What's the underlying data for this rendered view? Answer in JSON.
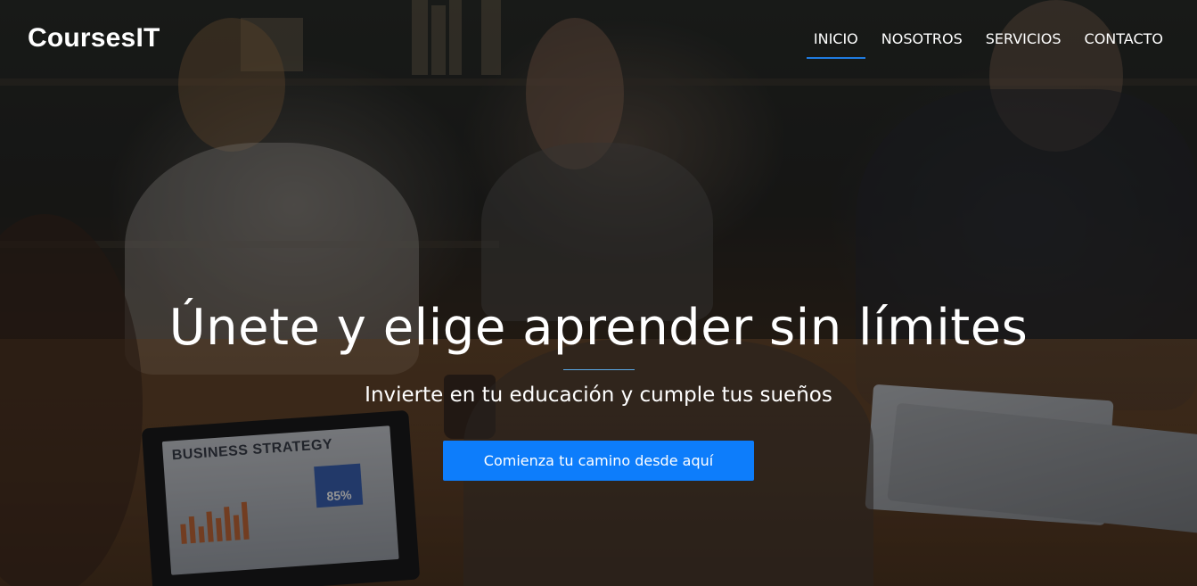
{
  "header": {
    "brand": "CoursesIT",
    "nav": [
      {
        "label": "INICIO",
        "active": true
      },
      {
        "label": "NOSOTROS",
        "active": false
      },
      {
        "label": "SERVICIOS",
        "active": false
      },
      {
        "label": "CONTACTO",
        "active": false
      }
    ]
  },
  "hero": {
    "title": "Únete y elige aprender sin límites",
    "subtitle": "Invierte en tu educación y cumple tus sueños",
    "cta_label": "Comienza tu camino desde aquí",
    "background_image": {
      "laptop_screen_title": "BUSINESS STRATEGY",
      "laptop_screen_stat": "85%"
    }
  },
  "colors": {
    "accent": "#0d7dfb",
    "nav_underline": "#1f7be0",
    "text": "#ffffff"
  }
}
